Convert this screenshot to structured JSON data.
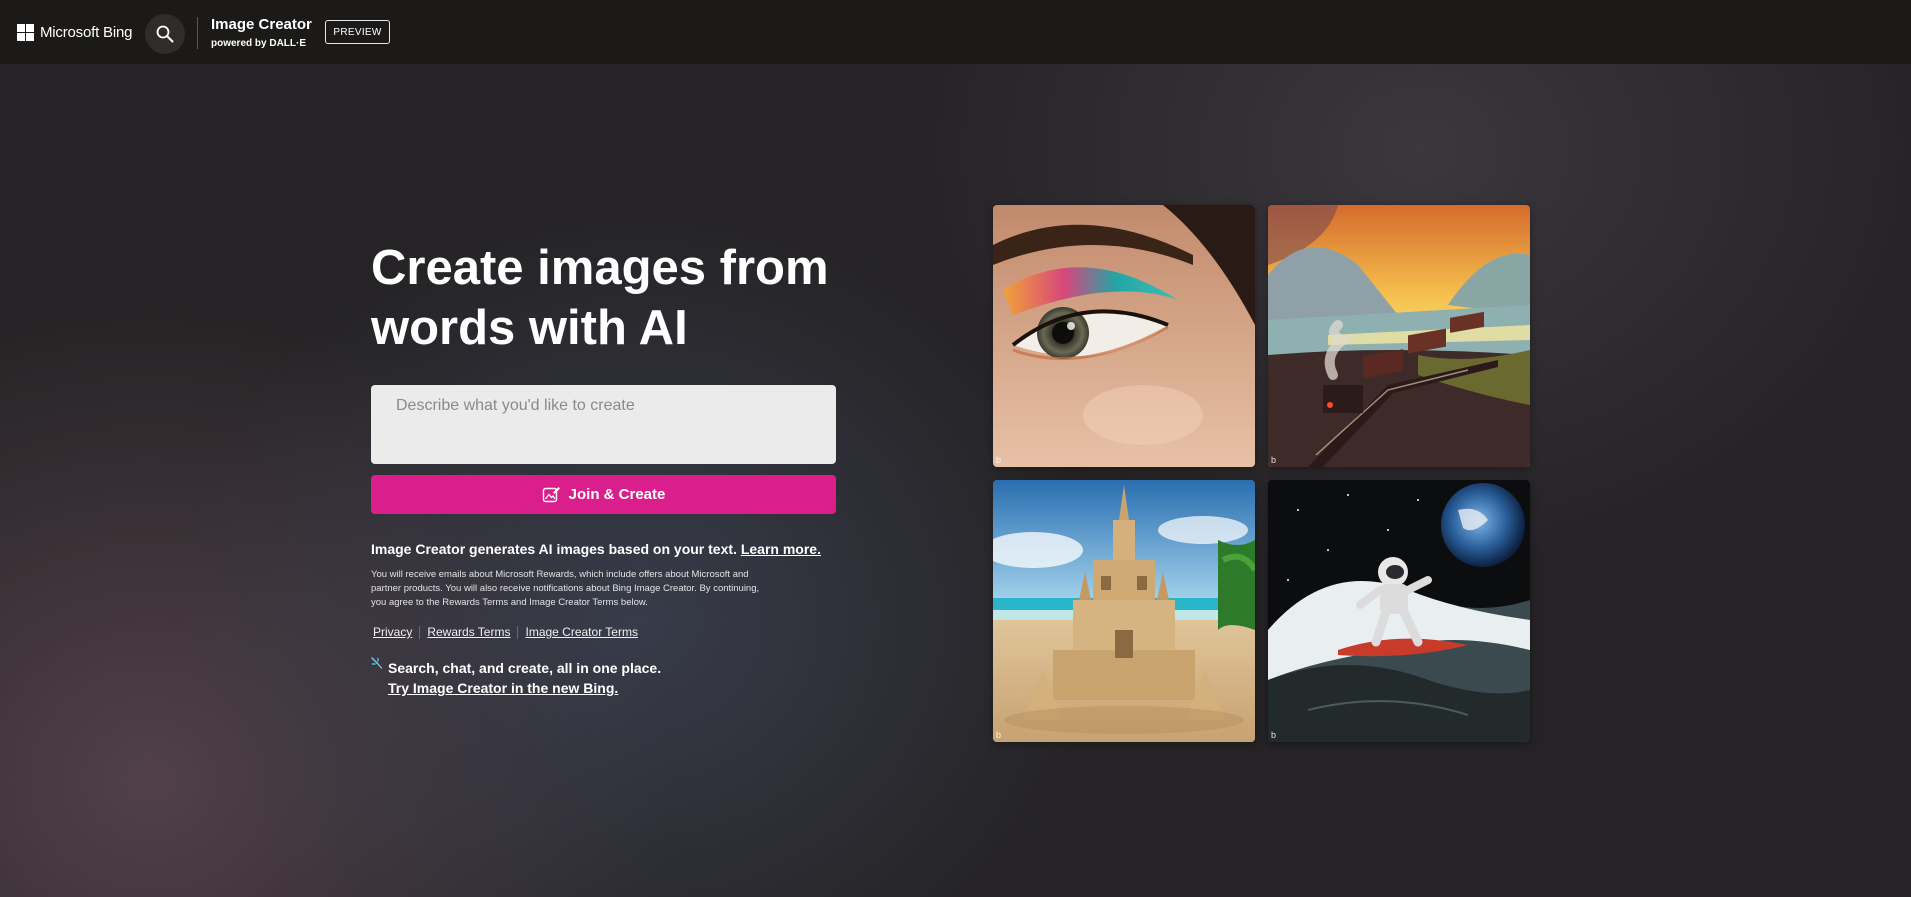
{
  "header": {
    "brand": "Microsoft Bing",
    "product_title": "Image Creator",
    "product_subtitle": "powered by DALL·E",
    "preview_badge": "PREVIEW",
    "icons": [
      "microsoft-logo-icon",
      "search-icon"
    ]
  },
  "hero": {
    "title_line1": "Create images from",
    "title_line2": "words with AI",
    "prompt_placeholder": "Describe what you'd like to create",
    "create_button": "Join & Create",
    "info_text": "Image Creator generates AI images based on your text.",
    "learn_more": "Learn more.",
    "legal_text": "You will receive emails about Microsoft Rewards, which include offers about Microsoft and partner products. You will also receive notifications about Bing Image Creator. By continuing, you agree to the Rewards Terms and Image Creator Terms below.",
    "links": [
      "Privacy",
      "Rewards Terms",
      "Image Creator Terms"
    ],
    "promo_text": "Search, chat, and create, all in one place.",
    "promo_link": "Try Image Creator in the new Bing."
  },
  "gallery": [
    {
      "subject": "eye-makeup"
    },
    {
      "subject": "steam-train-landscape"
    },
    {
      "subject": "sand-castle"
    },
    {
      "subject": "astronaut-surfing"
    }
  ],
  "colors": {
    "accent": "#da1f8d",
    "header_bg": "#1b1a19",
    "prompt_bg": "#ebebeb"
  }
}
